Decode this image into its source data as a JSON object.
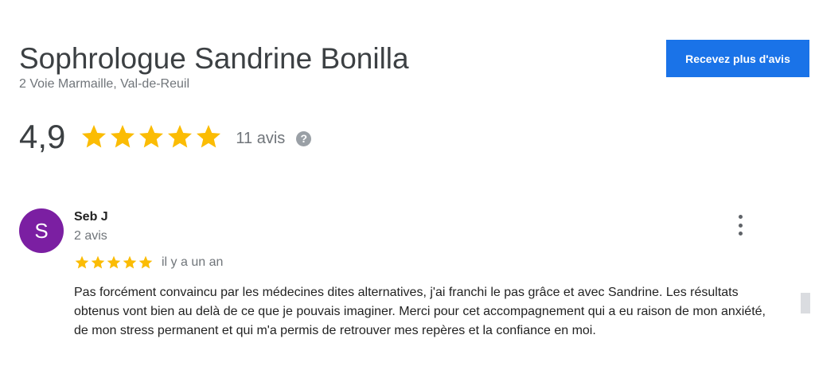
{
  "business": {
    "name": "Sophrologue Sandrine Bonilla",
    "address": "2 Voie Marmaille, Val-de-Reuil"
  },
  "actions": {
    "get_more_reviews_label": "Recevez plus d'avis"
  },
  "rating": {
    "score": "4,9",
    "stars": 5,
    "review_count": "11 avis",
    "help_icon": "question-mark-icon",
    "help_glyph": "?"
  },
  "review": {
    "avatar_letter": "S",
    "reviewer_name": "Seb J",
    "reviewer_review_count": "2 avis",
    "stars": 5,
    "date": "il y a un an",
    "text": "Pas forcément convaincu par les médecines dites alternatives, j'ai franchi le pas grâce et avec Sandrine. Les résultats obtenus vont bien au delà de ce que je pouvais imaginer. Merci pour cet accompagnement qui a eu raison de mon anxiété, de mon stress permanent et qui m'a permis de retrouver mes repères et la confiance en moi.",
    "menu_icon": "more-vertical-icon"
  },
  "colors": {
    "star": "#fbbc04",
    "button_bg": "#1a73e8",
    "avatar_bg": "#7b1fa2"
  }
}
